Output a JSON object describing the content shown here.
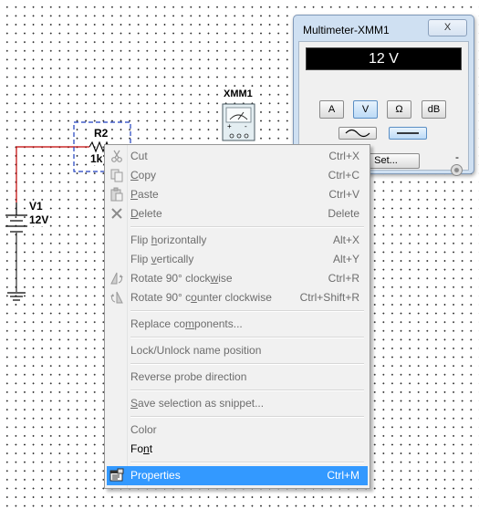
{
  "schematic": {
    "resistor": {
      "ref": "R2",
      "value": "1k"
    },
    "source": {
      "ref": "V1",
      "value": "12V"
    },
    "meter_ref": "XMM1",
    "wire_color": "#c00000",
    "selection_color": "#1f3fbf"
  },
  "multimeter": {
    "title": "Multimeter-XMM1",
    "close_label": "X",
    "reading": "12 V",
    "modes": [
      "A",
      "V",
      "Ω",
      "dB"
    ],
    "active_mode": "V",
    "plus": "+",
    "minus": "-",
    "set_label": "Set..."
  },
  "context_menu": {
    "items": [
      {
        "pre": "",
        "key": "",
        "post": "Cut",
        "shortcut": "Ctrl+X",
        "icon": "scissors-icon",
        "disabled": true
      },
      {
        "pre": "",
        "key": "C",
        "post": "opy",
        "shortcut": "Ctrl+C",
        "icon": "copy-icon",
        "disabled": true
      },
      {
        "pre": "",
        "key": "P",
        "post": "aste",
        "shortcut": "Ctrl+V",
        "icon": "paste-icon",
        "disabled": true
      },
      {
        "pre": "",
        "key": "D",
        "post": "elete",
        "shortcut": "Delete",
        "icon": "delete-icon",
        "disabled": true
      },
      {
        "pre": "Flip ",
        "key": "h",
        "post": "orizontally",
        "shortcut": "Alt+X",
        "icon": "",
        "disabled": true
      },
      {
        "pre": "Flip ",
        "key": "v",
        "post": "ertically",
        "shortcut": "Alt+Y",
        "icon": "",
        "disabled": true
      },
      {
        "pre": "Rotate 90° clock",
        "key": "w",
        "post": "ise",
        "shortcut": "Ctrl+R",
        "icon": "rotate-cw-icon",
        "disabled": true
      },
      {
        "pre": "Rotate 90° c",
        "key": "o",
        "post": "unter clockwise",
        "shortcut": "Ctrl+Shift+R",
        "icon": "rotate-ccw-icon",
        "disabled": true
      },
      {
        "pre": "Replace co",
        "key": "m",
        "post": "ponents...",
        "shortcut": "",
        "icon": "",
        "disabled": true
      },
      {
        "pre": "Lock/Unlock name position",
        "key": "",
        "post": "",
        "shortcut": "",
        "icon": "",
        "disabled": true
      },
      {
        "pre": "Reverse probe direction",
        "key": "",
        "post": "",
        "shortcut": "",
        "icon": "",
        "disabled": true
      },
      {
        "pre": "",
        "key": "S",
        "post": "ave selection as snippet...",
        "shortcut": "",
        "icon": "",
        "disabled": true
      },
      {
        "pre": "Color",
        "key": "",
        "post": "",
        "shortcut": "",
        "icon": "",
        "disabled": true
      },
      {
        "pre": "Fo",
        "key": "n",
        "post": "t",
        "shortcut": "",
        "icon": "",
        "disabled": false
      },
      {
        "pre": "",
        "key": "",
        "post": "Properties",
        "shortcut": "Ctrl+M",
        "icon": "properties-icon",
        "disabled": false,
        "selected": true
      }
    ]
  }
}
